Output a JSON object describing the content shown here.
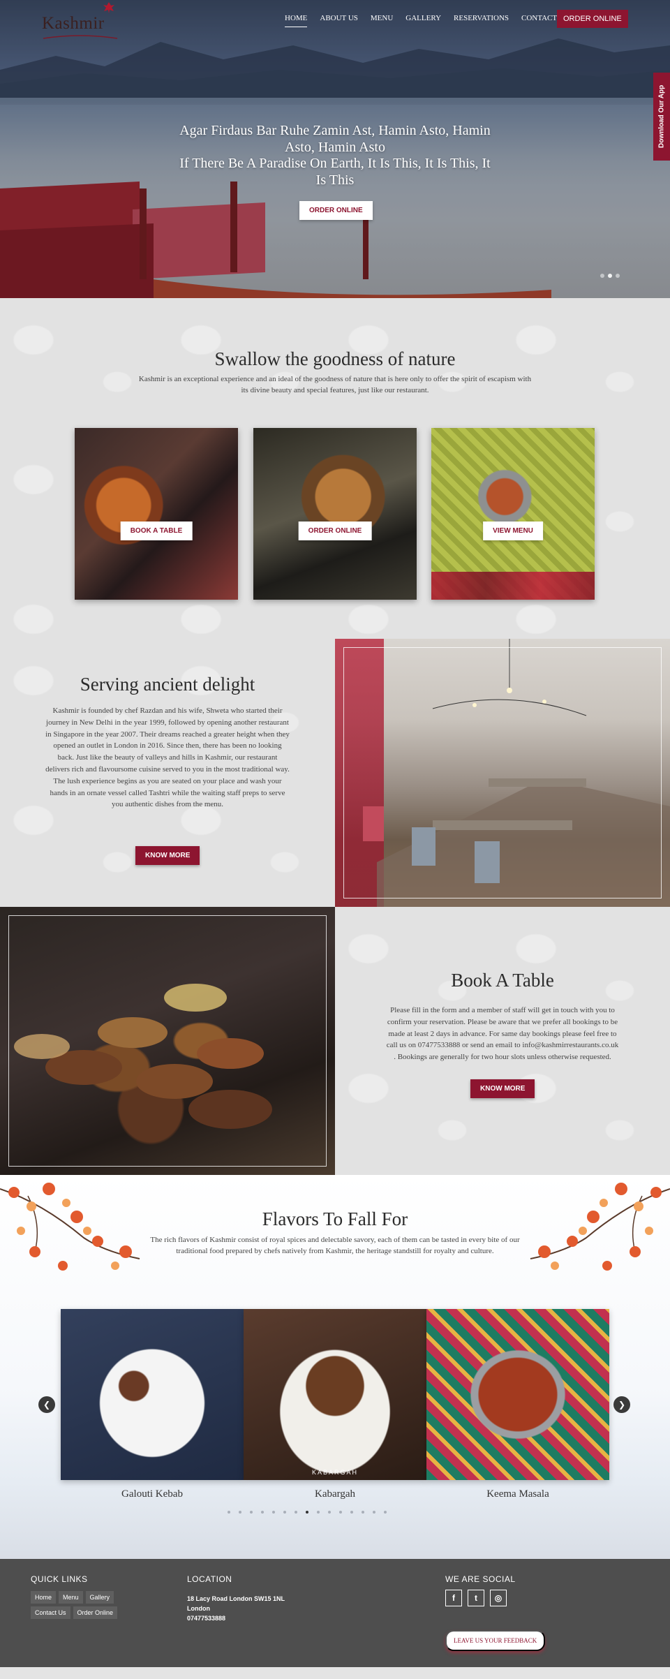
{
  "brand": {
    "logo_text": "Kashmir"
  },
  "nav": {
    "items": [
      {
        "label": "HOME"
      },
      {
        "label": "ABOUT US"
      },
      {
        "label": "MENU"
      },
      {
        "label": "GALLERY"
      },
      {
        "label": "RESERVATIONS"
      },
      {
        "label": "CONTACT US"
      }
    ],
    "order_button": "ORDER ONLINE",
    "side_tab": "Download Our App"
  },
  "hero": {
    "line1": "Agar Firdaus Bar Ruhe Zamin Ast, Hamin Asto, Hamin Asto, Hamin Asto",
    "line2": "If There Be A Paradise On Earth, It Is This, It Is This, It Is This",
    "button": "ORDER ONLINE"
  },
  "intro": {
    "title": "Swallow the goodness of nature",
    "text": "Kashmir is an exceptional experience and an ideal of the goodness of nature that is here only to offer the spirit of escapism with its divine beauty and special features, just like our restaurant.",
    "cards": [
      {
        "button": "BOOK A TABLE"
      },
      {
        "button": "ORDER ONLINE"
      },
      {
        "button": "VIEW MENU"
      }
    ]
  },
  "serve": {
    "title": "Serving ancient delight",
    "text": "Kashmir is founded by chef Razdan and his wife, Shweta who started their journey in New Delhi in the year 1999, followed by opening another restaurant in Singapore in the year 2007. Their dreams reached a greater height when they opened an outlet in London in 2016. Since then, there has been no looking back. Just like the beauty of valleys and hills in Kashmir, our restaurant delivers rich and flavoursome cuisine served to you in the most traditional way. The lush experience begins as you are seated on your place and wash your hands in an ornate vessel called Tashtri while the waiting staff preps to serve you authentic dishes from the menu.",
    "button": "KNOW MORE"
  },
  "book": {
    "title": "Book A Table",
    "text": "Please fill in the form and a member of staff will get in touch with you to confirm your reservation. Please be aware that we prefer all bookings to be made at least 2 days in advance. For same day bookings please feel free to call us on 07477533888 or send an email to info@kashmirrestaurants.co.uk . Bookings are generally for two hour slots unless otherwise requested.",
    "button": "KNOW MORE"
  },
  "flavors": {
    "title": "Flavors To Fall For",
    "text": "The rich flavors of Kashmir consist of royal spices and delectable savory, each of them can be tasted in every bite of our traditional food prepared by chefs natively from Kashmir, the heritage standstill for royalty and culture.",
    "dishes": [
      {
        "name": "Galouti Kebab",
        "caption": ""
      },
      {
        "name": "Kabargah",
        "caption": "KABARGAH"
      },
      {
        "name": "Keema Masala",
        "caption": ""
      }
    ],
    "prev_icon": "chevron-left-icon",
    "next_icon": "chevron-right-icon",
    "slide_count": 15,
    "active_slide": 7
  },
  "footer": {
    "quick_links_title": "QUICK LINKS",
    "quick_links": [
      "Home",
      "Menu",
      "Gallery",
      "Contact Us",
      "Order Online"
    ],
    "location_title": "LOCATION",
    "address_line1": "18 Lacy Road London SW15 1NL",
    "address_line2": "London",
    "phone": "07477533888",
    "social_title": "WE ARE SOCIAL",
    "social": [
      {
        "icon": "facebook-icon",
        "glyph": "f"
      },
      {
        "icon": "twitter-icon",
        "glyph": "t"
      },
      {
        "icon": "instagram-icon",
        "glyph": "◎"
      }
    ],
    "feedback_button": "LEAVE US YOUR FEEDBACK"
  },
  "colors": {
    "accent": "#8d1530",
    "footer": "#4e4e4e"
  }
}
